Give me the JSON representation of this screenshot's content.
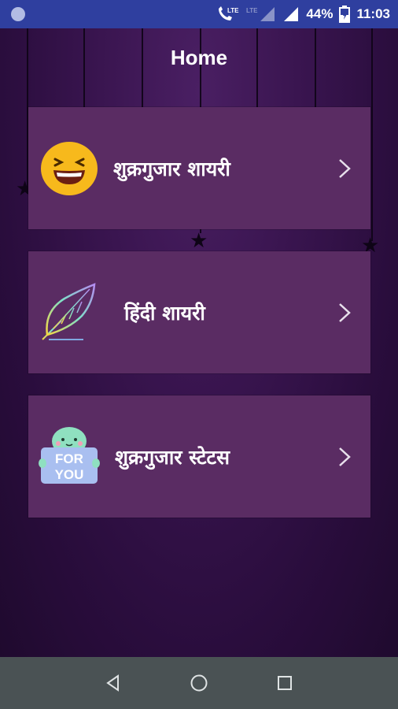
{
  "status_bar": {
    "battery": "44%",
    "time": "11:03",
    "network_label": "LTE"
  },
  "header": {
    "title": "Home"
  },
  "menu": [
    {
      "label": "शुक्रगुजार शायरी",
      "icon": "laughing-emoji-icon"
    },
    {
      "label": "हिंदी शायरी",
      "icon": "feather-quill-icon"
    },
    {
      "label": "शुक्रगुजार स्टेटस",
      "icon": "for-you-sign-icon"
    }
  ],
  "for_you_text": {
    "line1": "FOR",
    "line2": "YOU"
  },
  "colors": {
    "status_bar": "#2f3f9f",
    "card": "#5a2c63",
    "background": "#3a1550",
    "nav_bar": "#4a5254"
  },
  "nav_bar": {
    "back": "back-icon",
    "home": "home-icon",
    "recents": "recents-icon"
  }
}
